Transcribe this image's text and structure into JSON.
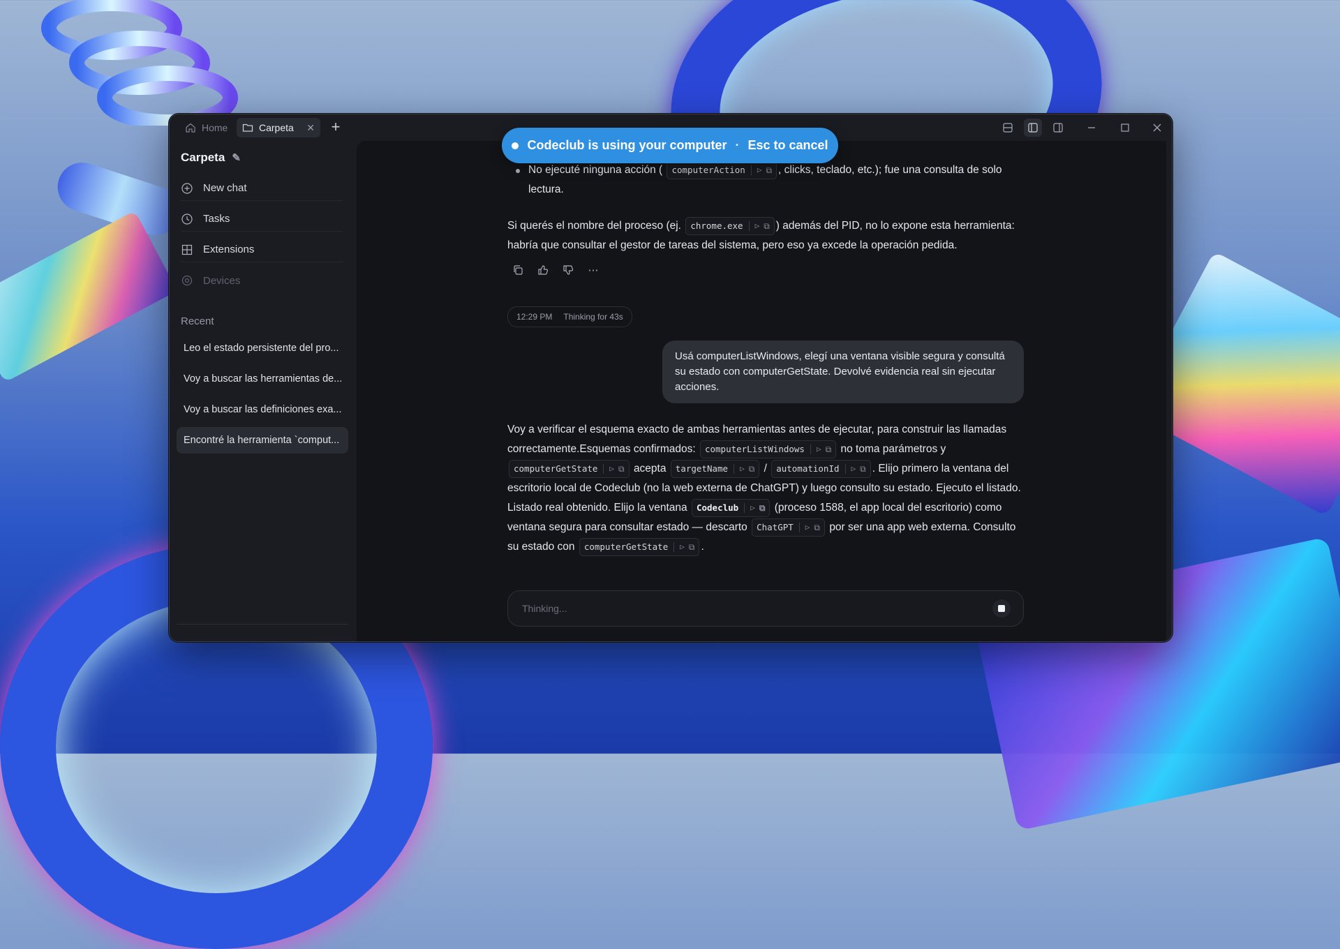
{
  "window": {
    "tabs": [
      {
        "label": "Home"
      },
      {
        "label": "Carpeta"
      }
    ],
    "controls": [
      "layout-icon",
      "sidebar-left-icon",
      "sidebar-right-icon",
      "minimize-icon",
      "maximize-icon",
      "close-icon"
    ]
  },
  "banner": {
    "text": "Codeclub is using your computer",
    "separator": "·",
    "cancel": "Esc to cancel"
  },
  "sidebar": {
    "folder_title": "Carpeta",
    "nav": [
      {
        "label": "New chat",
        "icon": "plus-circle-icon"
      },
      {
        "label": "Tasks",
        "icon": "clock-icon"
      },
      {
        "label": "Extensions",
        "icon": "grid-icon"
      },
      {
        "label": "Devices",
        "icon": "devices-icon"
      }
    ],
    "recent_label": "Recent",
    "recent": [
      {
        "label": "Leo el estado persistente del pro..."
      },
      {
        "label": "Voy a buscar las herramientas de..."
      },
      {
        "label": "Voy a buscar las definiciones exa..."
      },
      {
        "label": "Encontré la herramienta `comput..."
      }
    ]
  },
  "chat": {
    "bullet": {
      "pre": "No ejecuté ninguna acción (",
      "code": "computerAction",
      "post": ", clicks, teclado, etc.); fue una consulta de solo lectura."
    },
    "para1": {
      "pre": "Si querés el nombre del proceso (ej.",
      "code": "chrome.exe",
      "post": ") además del PID, no lo expone esta herramienta: habría que consultar el gestor de tareas del sistema, pero eso ya excede la operación pedida."
    },
    "status": {
      "time": "12:29 PM",
      "thinking": "Thinking for 43s"
    },
    "user_message": "Usá computerListWindows, elegí una ventana visible segura y consultá su estado con computerGetState. Devolvé evidencia real sin ejecutar acciones.",
    "para2": {
      "t1": "Voy a verificar el esquema exacto de ambas herramientas antes de ejecutar, para construir las llamadas correctamente.Esquemas confirmados:",
      "c1": "computerListWindows",
      "t2": "no toma parámetros y",
      "c2": "computerGetState",
      "t3": "acepta",
      "c3": "targetName",
      "t4": "/",
      "c4": "automationId",
      "t5": ". Elijo primero la ventana del escritorio local de Codeclub (no la web externa de ChatGPT) y luego consulto su estado. Ejecuto el listado."
    },
    "para3": {
      "t1": "Listado real obtenido. Elijo la ventana",
      "c1": "Codeclub",
      "t2": "(proceso 1588, el app local del escritorio) como ventana segura para consultar estado — descarto",
      "c2": "ChatGPT",
      "t3": "por ser una app web externa. Consulto su estado con",
      "c3": "computerGetState",
      "t4": "."
    },
    "composer": {
      "placeholder": "Thinking..."
    }
  }
}
